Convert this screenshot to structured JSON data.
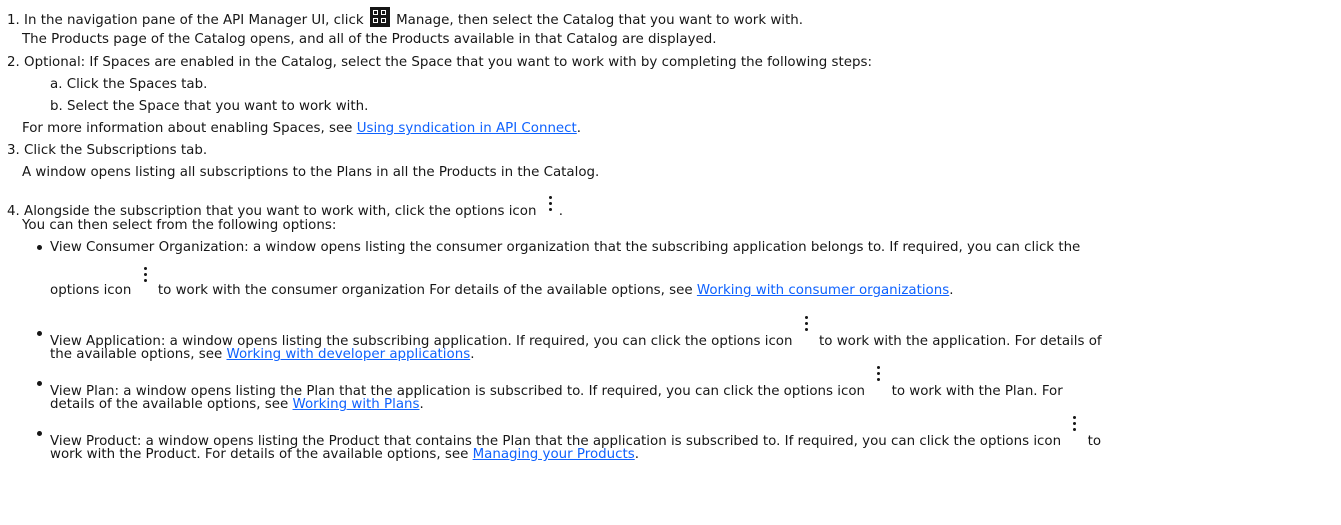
{
  "steps": {
    "s1": {
      "num": "1.",
      "pre": "In the navigation pane of the API Manager UI, click",
      "post": "Manage, then select the Catalog that you want to work with.",
      "result": "The Products page of the Catalog opens, and all of the Products available in that Catalog are displayed."
    },
    "s2": {
      "num": "2.",
      "text": "Optional: If Spaces are enabled in the Catalog, select the Space that you want to work with by completing the following steps:",
      "sub_a": "a. Click the Spaces tab.",
      "sub_b": "b. Select the Space that you want to work with.",
      "info_pre": "For more information about enabling Spaces, see",
      "info_link": "Using syndication in API Connect",
      "info_post": "."
    },
    "s3": {
      "num": "3.",
      "text": "Click the Subscriptions tab.",
      "result": "A window opens listing all subscriptions to the Plans in all the Products in the Catalog."
    },
    "s4": {
      "num": "4.",
      "pre": "Alongside the subscription that you want to work with, click the options icon",
      "post": ".",
      "result": "You can then select from the following options:"
    }
  },
  "options": [
    {
      "line1": "View Consumer Organization: a window opens listing the consumer organization that the subscribing application belongs to. If required, you can click the",
      "line2_pre": "options icon",
      "line2_mid": "to work with the consumer organization For details of the available options, see",
      "link": "Working with consumer organizations",
      "post": "."
    },
    {
      "line1_pre": "View Application: a window opens listing the subscribing application. If required, you can click the options icon",
      "line1_post": "to work with the application. For details of",
      "line2_pre": "the available options, see",
      "link": "Working with developer applications",
      "post": "."
    },
    {
      "line1_pre": "View Plan: a window opens listing the Plan that the application is subscribed to. If required, you can click the options icon",
      "line1_post": "to work with the Plan. For",
      "line2_pre": "details of the available options, see",
      "link": "Working with Plans",
      "post": "."
    },
    {
      "line1_pre": "View Product: a window opens listing the Product that contains the Plan that the application is subscribed to. If required, you can click the options icon",
      "line1_post": "to",
      "line2_pre": "work with the Product. For details of the available options, see",
      "link": "Managing your Products",
      "post": "."
    }
  ],
  "icons": {
    "manage": "grid-icon",
    "options": "overflow-menu-vertical-icon"
  },
  "colors": {
    "link": "#0f62fe",
    "text": "#161616"
  }
}
